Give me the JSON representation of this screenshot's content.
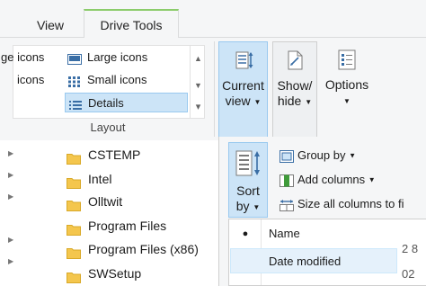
{
  "tabs": [
    {
      "label": "View"
    },
    {
      "label": "Drive Tools"
    }
  ],
  "layout": {
    "items": {
      "extra_large_partial": "ge icons",
      "medium_partial": "icons",
      "large": "Large icons",
      "small": "Small icons",
      "details": "Details"
    },
    "group_label": "Layout"
  },
  "buttons": {
    "current_view": [
      "Current",
      "view"
    ],
    "show_hide": [
      "Show/",
      "hide"
    ],
    "options": "Options"
  },
  "sort": {
    "button": [
      "Sort",
      "by"
    ],
    "group_by": "Group by",
    "add_columns": "Add columns",
    "size_all": "Size all columns to fi",
    "menu": [
      {
        "label": "Name",
        "selected": true
      },
      {
        "label": "Date modified",
        "selected": false
      }
    ],
    "cut_values": [
      "2 8",
      "02"
    ]
  },
  "folders": [
    "CSTEMP",
    "Intel",
    "Olltwit",
    "Program Files",
    "Program Files (x86)",
    "SWSetup"
  ],
  "colors": {
    "selection_bg": "#cce4f7",
    "selection_border": "#99c9ef",
    "folder": "#f4c64d",
    "tab_accent": "#8bcc6b"
  }
}
